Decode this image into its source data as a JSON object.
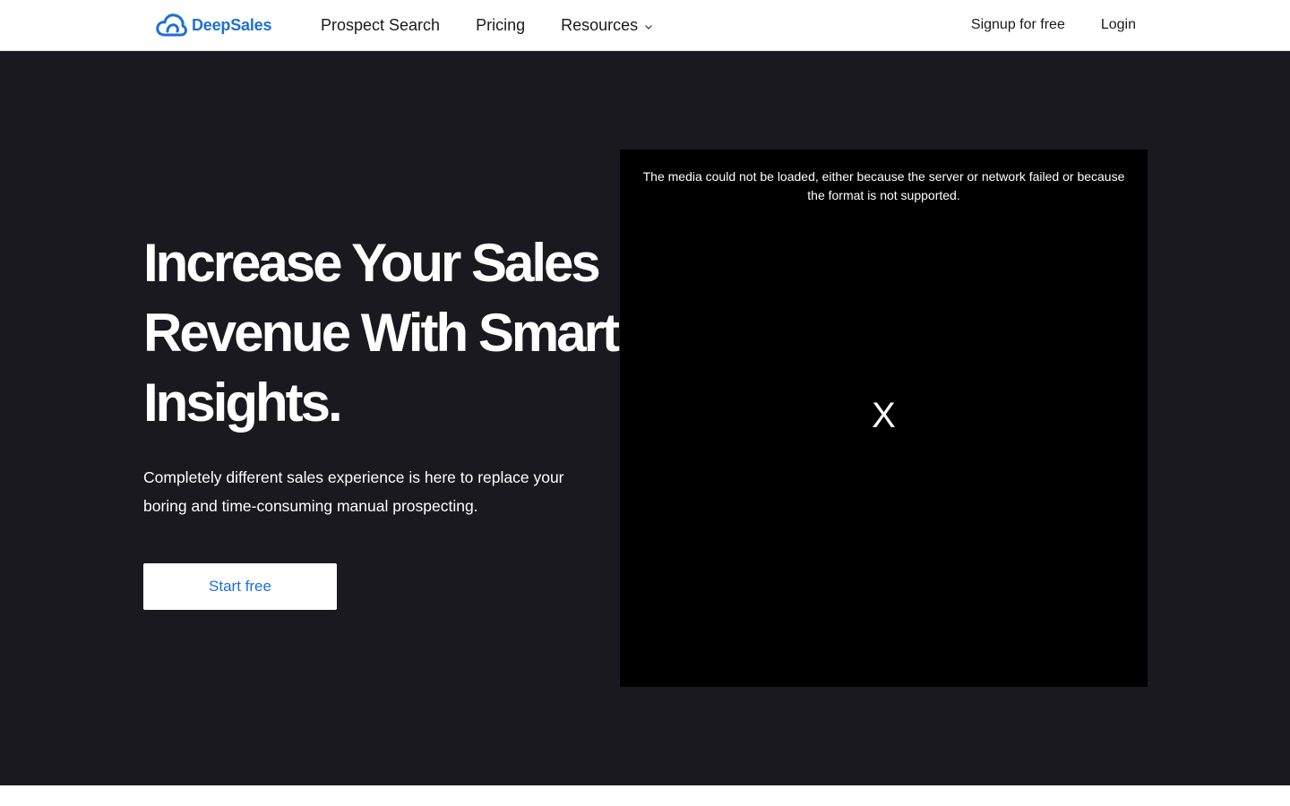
{
  "header": {
    "logo_text": "DeepSales",
    "logo_icon": "cloud-logo-icon",
    "nav": [
      {
        "label": "Prospect Search"
      },
      {
        "label": "Pricing"
      },
      {
        "label": "Resources",
        "icon": "chevron-down-icon"
      }
    ],
    "signup_label": "Signup for free",
    "login_label": "Login"
  },
  "hero": {
    "title": "Increase Your Sales Revenue With Smart Insights.",
    "subtitle": "Completely different sales experience is here to replace your boring and time-consuming manual prospecting.",
    "cta_label": "Start free"
  },
  "media": {
    "error_text": "The media could not be loaded, either because the server or network failed or because the format is not supported.",
    "close_label": "X"
  },
  "colors": {
    "brand_blue": "#1f6fd6",
    "hero_bg": "#1a191f",
    "media_bg": "#000000"
  }
}
